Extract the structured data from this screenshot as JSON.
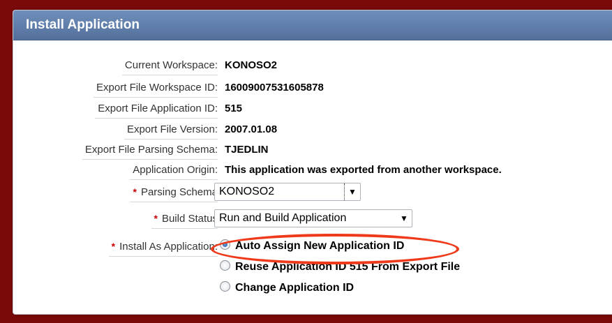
{
  "header": {
    "title": "Install Application"
  },
  "fields": [
    {
      "label": "Current Workspace:",
      "value": "KONOSO2"
    },
    {
      "label": "Export File Workspace ID:",
      "value": "16009007531605878"
    },
    {
      "label": "Export File Application ID:",
      "value": "515"
    },
    {
      "label": "Export File Version:",
      "value": "2007.01.08"
    },
    {
      "label": "Export File Parsing Schema:",
      "value": "TJEDLIN"
    },
    {
      "label": "Application Origin:",
      "value": "This application was exported from another workspace."
    }
  ],
  "parsing_schema": {
    "label": "Parsing Schema",
    "value": "KONOSO2"
  },
  "build_status": {
    "label": "Build Status",
    "value": "Run and Build Application"
  },
  "install_as": {
    "label": "Install As Application:",
    "options": [
      "Auto Assign New Application ID",
      "Reuse Application ID 515 From Export File",
      "Change Application ID"
    ],
    "selected_index": 0
  },
  "required_marker": "*",
  "colors": {
    "required": "#cc0000",
    "highlight": "#ee3a1b",
    "header": "#5f7ca6",
    "background": "#7a0a0a"
  }
}
